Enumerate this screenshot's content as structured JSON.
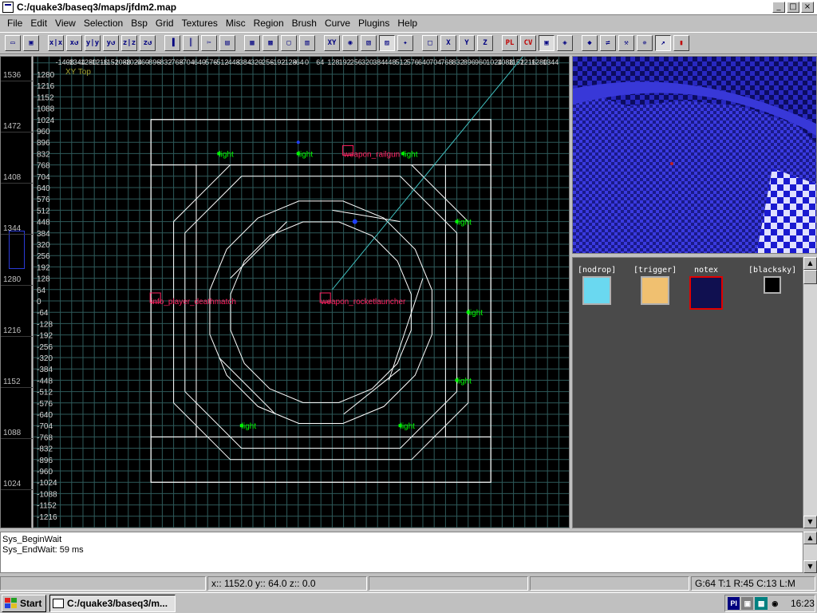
{
  "window": {
    "title": "C:/quake3/baseq3/maps/jfdm2.map"
  },
  "menu": [
    "File",
    "Edit",
    "View",
    "Selection",
    "Bsp",
    "Grid",
    "Textures",
    "Misc",
    "Region",
    "Brush",
    "Curve",
    "Plugins",
    "Help"
  ],
  "toolbar": {
    "buttons": [
      {
        "name": "open",
        "glyph": "▭"
      },
      {
        "name": "save",
        "glyph": "▣"
      },
      {
        "name": "x-axis-flip",
        "glyph": "x|x"
      },
      {
        "name": "x-axis-rotate",
        "glyph": "x↺"
      },
      {
        "name": "y-axis-flip",
        "glyph": "y|y"
      },
      {
        "name": "y-axis-rotate",
        "glyph": "y↺"
      },
      {
        "name": "z-axis-flip",
        "glyph": "z|z"
      },
      {
        "name": "z-axis-rotate",
        "glyph": "z↺"
      },
      {
        "name": "complete-tall",
        "glyph": "▐"
      },
      {
        "name": "size-to-fit",
        "glyph": "║"
      },
      {
        "name": "clipper",
        "glyph": "✂"
      },
      {
        "name": "select-inside",
        "glyph": "▤"
      },
      {
        "name": "csg-hollow",
        "glyph": "▦"
      },
      {
        "name": "csg-subtract",
        "glyph": "▩"
      },
      {
        "name": "csg-merge",
        "glyph": "▢"
      },
      {
        "name": "change-views",
        "glyph": "▥"
      },
      {
        "name": "xyz",
        "glyph": "XY"
      },
      {
        "name": "texture-lock",
        "glyph": "◉"
      },
      {
        "name": "cubic-clip",
        "glyph": "▧"
      },
      {
        "name": "camera-preview",
        "glyph": "▨"
      },
      {
        "name": "free-rotate",
        "glyph": "✦"
      },
      {
        "name": "lock-x",
        "glyph": "□"
      },
      {
        "name": "lock-x-toggle",
        "glyph": "X"
      },
      {
        "name": "lock-y",
        "glyph": "Y"
      },
      {
        "name": "lock-z",
        "glyph": "Z"
      },
      {
        "name": "show-patches",
        "glyph": "PL"
      },
      {
        "name": "show-curves",
        "glyph": "CV"
      },
      {
        "name": "select-patch",
        "glyph": "▣"
      },
      {
        "name": "patch-bend",
        "glyph": "◈"
      },
      {
        "name": "patch-insert",
        "glyph": "◆"
      },
      {
        "name": "patch-delete",
        "glyph": "⇌"
      },
      {
        "name": "patch-cap",
        "glyph": "⚒"
      },
      {
        "name": "patch-weld",
        "glyph": "✵"
      },
      {
        "name": "patch-drill",
        "glyph": "↗"
      },
      {
        "name": "patch-show-bb",
        "glyph": "▮"
      }
    ]
  },
  "z_ruler": {
    "labels": [
      "1536",
      "1472",
      "1408",
      "1344",
      "1280",
      "1216",
      "1152",
      "1088",
      "1024"
    ]
  },
  "xy_view": {
    "label": "XY Top",
    "y_labels": [
      "1280",
      "1216",
      "1152",
      "1088",
      "1024",
      "960",
      "896",
      "832",
      "768",
      "704",
      "640",
      "576",
      "512",
      "448",
      "384",
      "320",
      "256",
      "192",
      "128",
      "64",
      "0",
      "-64",
      "-128",
      "-192",
      "-256",
      "-320",
      "-384",
      "-448",
      "-512",
      "-576",
      "-640",
      "-704",
      "-768",
      "-832",
      "-896",
      "-960",
      "-1024",
      "-1088",
      "-1152",
      "-1216"
    ],
    "x_labels": [
      "-1408",
      "-1344",
      "-1280",
      "-1216",
      "-1152",
      "-1088",
      "-1024",
      "-960",
      "-896",
      "-832",
      "-768",
      "-704",
      "-640",
      "-576",
      "-512",
      "-448",
      "-384",
      "-320",
      "-256",
      "-192",
      "-128",
      "-64",
      "0",
      "64",
      "128",
      "192",
      "256",
      "320",
      "384",
      "448",
      "512",
      "576",
      "640",
      "704",
      "768",
      "832",
      "896",
      "960",
      "1024",
      "1088",
      "1152",
      "1216",
      "1280",
      "1344"
    ],
    "entities": [
      {
        "text": "light",
        "color": "#00ff00"
      },
      {
        "text": "light",
        "color": "#00ff00"
      },
      {
        "text": "weapon_railgun",
        "color": "#ff2060"
      },
      {
        "text": "light",
        "color": "#00ff00"
      },
      {
        "text": "light",
        "color": "#00ff00"
      },
      {
        "text": "info_player_deathmatch",
        "color": "#ff2060"
      },
      {
        "text": "weapon_rocketlauncher",
        "color": "#ff2060"
      },
      {
        "text": "light",
        "color": "#00ff00"
      },
      {
        "text": "light",
        "color": "#00ff00"
      },
      {
        "text": "light",
        "color": "#00ff00"
      },
      {
        "text": "light",
        "color": "#00ff00"
      }
    ],
    "colors": {
      "grid": "#2e5a5a",
      "grid_major": "#3f7a7a",
      "brush": "#ffffff",
      "camera": "#40c0c0"
    }
  },
  "textures": [
    {
      "name": "[nodrop]",
      "swatch": "#6ad8f0"
    },
    {
      "name": "[trigger]",
      "swatch": "#f0c070"
    },
    {
      "name": "notex",
      "swatch": "#101050"
    },
    {
      "name": "[blacksky]",
      "swatch": "#000000"
    }
  ],
  "console": {
    "lines": [
      "Sys_BeginWait",
      "Sys_EndWait: 59 ms"
    ]
  },
  "status": {
    "coords": "x:: 1152.0  y:: 64.0  z:: 0.0",
    "grid_info": "G:64 T:1 R:45 C:13 L:M"
  },
  "taskbar": {
    "start_label": "Start",
    "task_label": "C:/quake3/baseq3/m...",
    "clock": "16:23"
  }
}
